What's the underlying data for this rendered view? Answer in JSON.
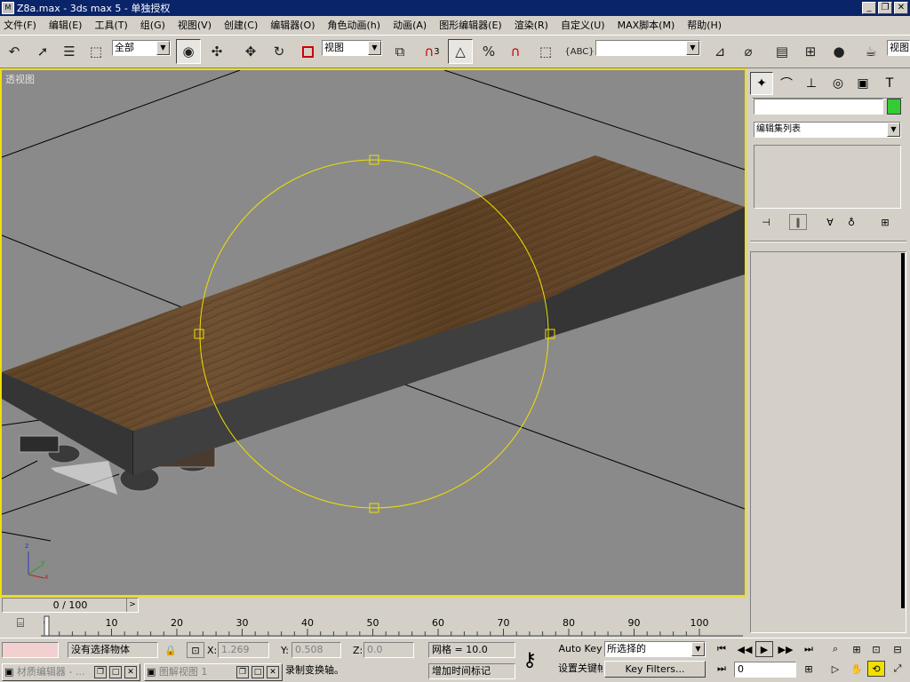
{
  "window": {
    "title": "Z8a.max - 3ds max 5 - 单独授权",
    "app_icon": "3ds-max-icon"
  },
  "menu": [
    "文件(F)",
    "编辑(E)",
    "工具(T)",
    "组(G)",
    "视图(V)",
    "创建(C)",
    "编辑器(O)",
    "角色动画(h)",
    "动画(A)",
    "图形编辑器(E)",
    "渲染(R)",
    "自定义(U)",
    "MAX脚本(M)",
    "帮助(H)"
  ],
  "toolbar": {
    "selection_filter": "全部",
    "ref_coord": "视图",
    "snap_label": "3",
    "named_selection": "",
    "right_label": "视图"
  },
  "viewport": {
    "label": "透视图",
    "axis_labels": {
      "x": "x",
      "y": "y",
      "z": "z"
    },
    "border_color": "#f0e000",
    "grid_color": "#000000",
    "gizmo_color": "#f0e000",
    "object": "wooden-flatcar"
  },
  "command_panel": {
    "tabs": [
      "create-icon",
      "modify-icon",
      "hierarchy-icon",
      "motion-icon",
      "display-icon",
      "utilities-icon"
    ],
    "name_value": "",
    "color_swatch": "#33cc33",
    "modifier_list": "编辑集列表"
  },
  "time": {
    "slider_text": "0 / 100",
    "ticks": [
      "0",
      "10",
      "20",
      "30",
      "40",
      "50",
      "60",
      "70",
      "80",
      "90",
      "100"
    ],
    "current_frame": 0,
    "total_frames": 100
  },
  "status": {
    "maxscript_listener": "",
    "selection_text": "没有选择物体",
    "x_label": "X:",
    "x_value": "1.269",
    "y_label": "Y:",
    "y_value": "0.508",
    "z_label": "Z:",
    "z_value": "0.0",
    "grid_text": "网格 = 10.0",
    "prompt_text": "录制变换轴。",
    "add_time_tag": "增加时间标记",
    "auto_key": "Auto Key",
    "set_key": "设置关键帧",
    "key_mode_select": "所选择的",
    "key_filters": "Key Filters...",
    "frame_field": "0"
  },
  "taskbar": [
    {
      "label": "材质编辑器 - ..."
    },
    {
      "label": "图解视图 1"
    }
  ]
}
